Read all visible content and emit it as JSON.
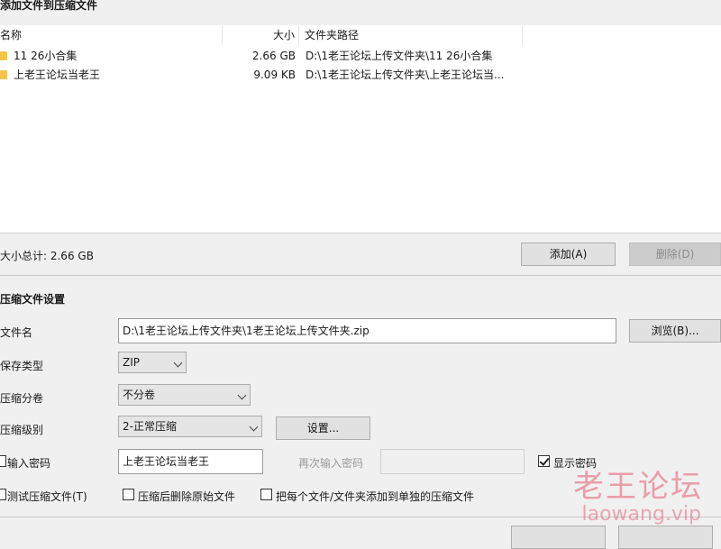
{
  "dialog": {
    "title": "添加文件到压缩文件"
  },
  "list": {
    "columns": [
      "名称",
      "大小",
      "文件夹路径"
    ],
    "rows": [
      {
        "name": "11 26小合集",
        "size": "2.66 GB",
        "path": "D:\\1老王论坛上传文件夹\\11 26小合集",
        "icon": "folder-icon"
      },
      {
        "name": "上老王论坛当老王",
        "size": "9.09 KB",
        "path": "D:\\1老王论坛上传文件夹\\上老王论坛当...",
        "icon": "folder-icon"
      }
    ]
  },
  "summary": {
    "total_label": "大小总计: 2.66 GB",
    "add_button": "添加(A)",
    "delete_button": "删除(D)"
  },
  "settings": {
    "section_title": "压缩文件设置",
    "filename_label": "文件名",
    "filename_value": "D:\\1老王论坛上传文件夹\\1老王论坛上传文件夹.zip",
    "browse_button": "浏览(B)...",
    "type_label": "保存类型",
    "type_value": "ZIP",
    "split_label": "压缩分卷",
    "split_value": "不分卷",
    "level_label": "压缩级别",
    "level_value": "2-正常压缩",
    "settings_button": "设置...",
    "password_label": "输入密码",
    "password_value": "上老王论坛当老王",
    "repeat_password_placeholder": "再次输入密码",
    "show_password_label": "显示密码",
    "test_label": "测试压缩文件(T)",
    "delete_after_label": "压缩后删除原始文件",
    "each_separate_label": "把每个文件/文件夹添加到单独的压缩文件"
  },
  "state": {
    "password_checked": false,
    "show_password_checked": true,
    "test_checked": false,
    "delete_after_checked": false,
    "each_separate_checked": false
  },
  "watermark": {
    "line1": "老王论坛",
    "line2": "laowang.vip"
  }
}
